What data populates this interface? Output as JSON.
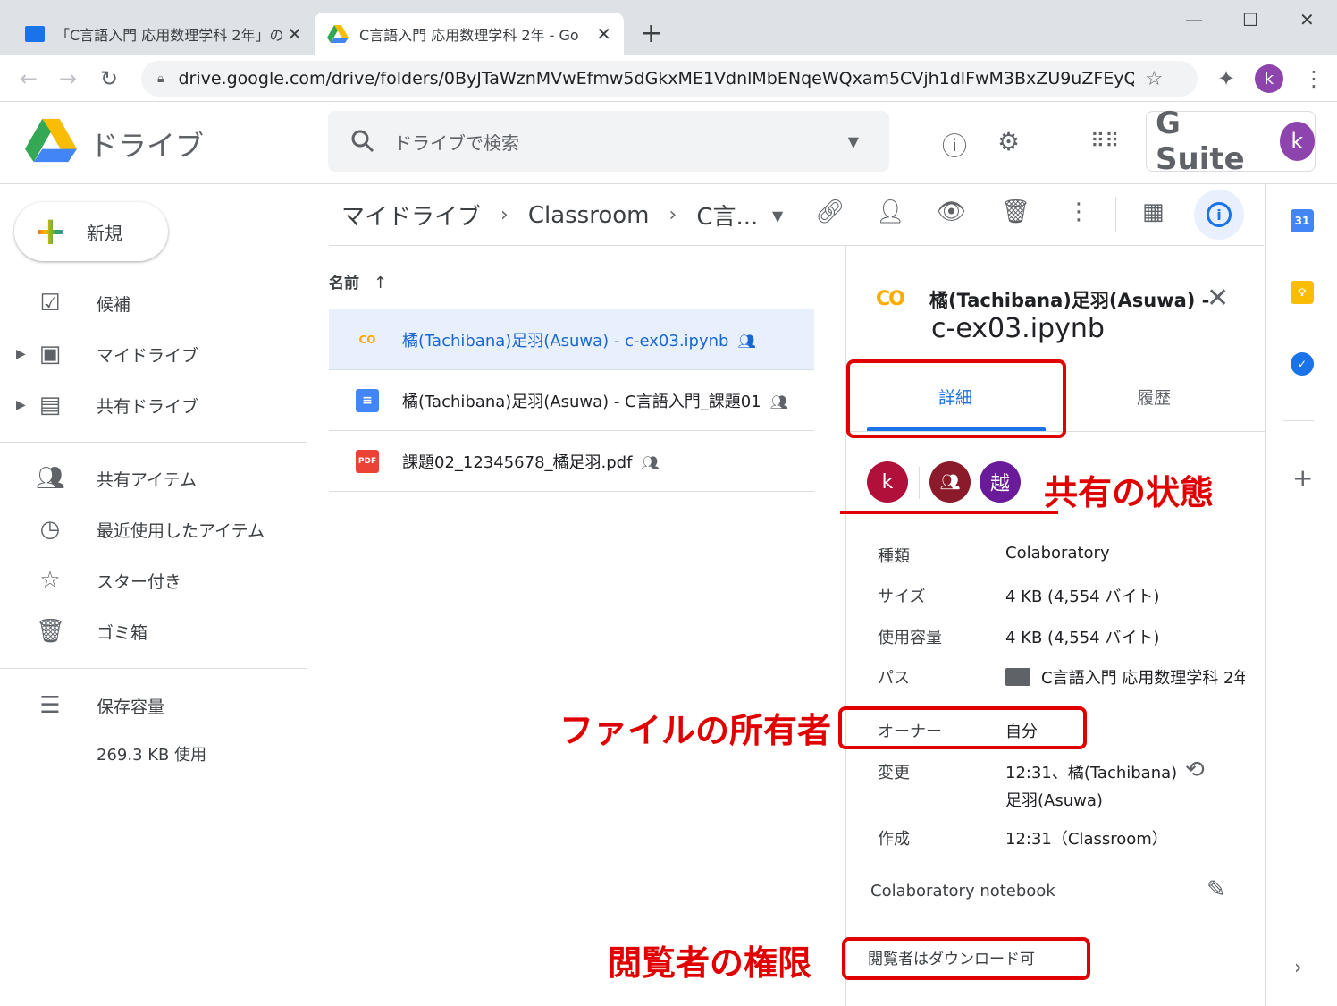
{
  "browser": {
    "tabs": [
      {
        "title": "「C言語入門 応用数理学科 2年」の"
      },
      {
        "title": "C言語入門 応用数理学科 2年 - Go"
      }
    ],
    "url": "drive.google.com/drive/folders/0ByJTaWznMVwEfmw5dGkxME1VdnlMbENqeWQxam5CVjh1dlFwM3BxZU9uZFEyQzlwTG...",
    "profile_initial": "k"
  },
  "header": {
    "app_title": "ドライブ",
    "search_placeholder": "ドライブで検索",
    "brand": "G Suite",
    "account_initial": "k"
  },
  "sidebar": {
    "new_label": "新規",
    "items": [
      {
        "label": "候補",
        "icon": "suggested-icon"
      },
      {
        "label": "マイドライブ",
        "icon": "my-drive-icon"
      },
      {
        "label": "共有ドライブ",
        "icon": "shared-drive-icon"
      },
      {
        "label": "共有アイテム",
        "icon": "people-icon"
      },
      {
        "label": "最近使用したアイテム",
        "icon": "clock-icon"
      },
      {
        "label": "スター付き",
        "icon": "star-icon"
      },
      {
        "label": "ゴミ箱",
        "icon": "trash-icon"
      },
      {
        "label": "保存容量",
        "icon": "storage-icon"
      }
    ],
    "storage_used": "269.3 KB 使用"
  },
  "breadcrumb": [
    "マイドライブ",
    "Classroom",
    "C言..."
  ],
  "file_list": {
    "column_name": "名前",
    "files": [
      {
        "name": "橘(Tachibana)足羽(Asuwa) - c-ex03.ipynb",
        "type_icon": "CO",
        "selected": true
      },
      {
        "name": "橘(Tachibana)足羽(Asuwa) - C言語入門_課題01",
        "type_icon": "doc",
        "selected": false
      },
      {
        "name": "課題02_12345678_橘足羽.pdf",
        "type_icon": "PDF",
        "selected": false
      }
    ]
  },
  "details": {
    "title_line1": "橘(Tachibana)足羽(Asuwa) -",
    "title_line2": "c-ex03.ipynb",
    "tabs": [
      "詳細",
      "履歴"
    ],
    "share_avatars": [
      {
        "label": "k",
        "color": "#b0103a"
      },
      {
        "label": "group",
        "color": "#8b1a2b"
      },
      {
        "label": "越",
        "color": "#6a1b9a"
      }
    ],
    "rows": [
      {
        "key": "種類",
        "value": "Colaboratory"
      },
      {
        "key": "サイズ",
        "value": "4 KB (4,554 バイト)"
      },
      {
        "key": "使用容量",
        "value": "4 KB (4,554 バイト)"
      },
      {
        "key": "パス",
        "value": "C言語入門 応用数理学科 2年"
      },
      {
        "key": "オーナー",
        "value": "自分"
      },
      {
        "key": "変更",
        "value": "12:31、橘(Tachibana)",
        "value2": "足羽(Asuwa)"
      },
      {
        "key": "作成",
        "value": "12:31（Classroom）"
      }
    ],
    "description": "Colaboratory notebook",
    "permission": "閲覧者はダウンロード可"
  },
  "annotations": {
    "sharing_state": "共有の状態",
    "file_owner": "ファイルの所有者",
    "viewer_permission": "閲覧者の権限"
  },
  "colors": {
    "accent": "#1a73e8",
    "annotation": "#e00000"
  }
}
